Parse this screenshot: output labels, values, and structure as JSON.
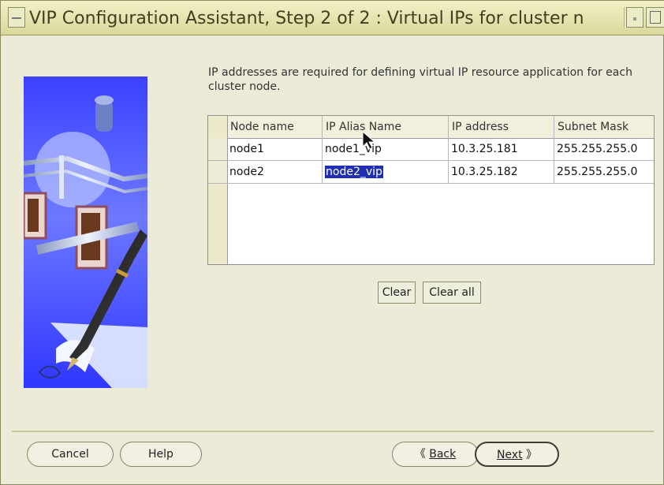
{
  "window": {
    "title": "VIP Configuration Assistant, Step 2 of 2 : Virtual IPs for cluster n"
  },
  "description": "IP addresses are required for defining virtual IP resource application for each cluster node.",
  "table": {
    "headers": [
      "Node name",
      "IP Alias Name",
      "IP address",
      "Subnet Mask"
    ],
    "rows": [
      [
        "node1",
        "node1_vip",
        "10.3.25.181",
        "255.255.255.0"
      ],
      [
        "node2",
        "node2_vip",
        "10.3.25.182",
        "255.255.255.0"
      ]
    ]
  },
  "actions": {
    "clear": "Clear",
    "clear_all": "Clear all"
  },
  "footer": {
    "cancel": "Cancel",
    "help": "Help",
    "back": "Back",
    "next": "Next"
  },
  "icons": {
    "back": "chevron-left",
    "next": "chevron-right",
    "pointer": "mouse-pointer"
  },
  "colors": {
    "selection": "#1f2fb0",
    "panel": "#3b41ff"
  }
}
